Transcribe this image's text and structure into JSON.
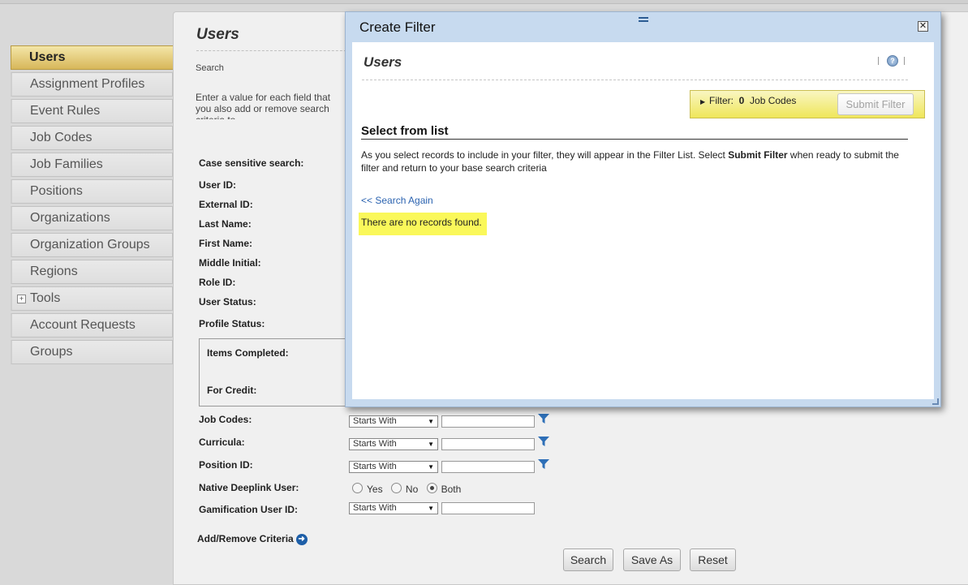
{
  "sidebar": {
    "items": [
      {
        "label": "Users"
      },
      {
        "label": "Assignment Profiles"
      },
      {
        "label": "Event Rules"
      },
      {
        "label": "Job Codes"
      },
      {
        "label": "Job Families"
      },
      {
        "label": "Positions"
      },
      {
        "label": "Organizations"
      },
      {
        "label": "Organization Groups"
      },
      {
        "label": "Regions"
      },
      {
        "label": "Tools"
      },
      {
        "label": "Account Requests"
      },
      {
        "label": "Groups"
      }
    ]
  },
  "page": {
    "title": "Users",
    "subtitle": "Search",
    "instructions": "Enter a value for each field that you also add or remove search criteria to"
  },
  "form": {
    "case_sensitive": "Case sensitive search:",
    "user_id": "User ID:",
    "external_id": "External ID:",
    "last_name": "Last Name:",
    "first_name": "First Name:",
    "middle_initial": "Middle Initial:",
    "role_id": "Role ID:",
    "user_status": "User Status:",
    "profile_status": "Profile Status:",
    "items_completed": "Items Completed:",
    "for_credit": "For Credit:",
    "job_codes": "Job Codes:",
    "curricula": "Curricula:",
    "position_id": "Position ID:",
    "native_deeplink": "Native Deeplink User:",
    "gamification": "Gamification User ID:",
    "starts_with": "Starts With",
    "radio_yes": "Yes",
    "radio_no": "No",
    "radio_both": "Both",
    "add_remove": "Add/Remove Criteria"
  },
  "buttons": {
    "search": "Search",
    "save_as": "Save As",
    "reset": "Reset"
  },
  "modal": {
    "title": "Create Filter",
    "inner_title": "Users",
    "filter_prefix": "Filter:",
    "filter_count": "0",
    "filter_type": "Job Codes",
    "submit_filter": "Submit Filter",
    "select_heading": "Select from list",
    "help_before": "As you select records to include in your filter, they will appear in the Filter List. Select ",
    "help_bold": "Submit Filter",
    "help_after": " when ready to submit the filter and return to your base search criteria",
    "search_again": "<< Search Again",
    "no_records": "There are no records found."
  },
  "colors": {
    "accent_gold": "#d8b75a",
    "modal_frame": "#c7daef",
    "highlight_yellow": "#faf85a",
    "link_blue": "#2b63b0"
  }
}
